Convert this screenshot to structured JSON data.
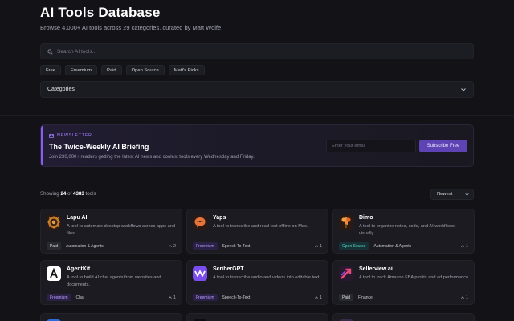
{
  "header": {
    "title": "AI Tools Database",
    "subtitle": "Browse 4,000+ AI tools across 29 categories, curated by Matt Wolfe"
  },
  "search": {
    "placeholder": "Search AI tools..."
  },
  "filters": [
    "Free",
    "Freemium",
    "Paid",
    "Open Source",
    "Matt's Picks"
  ],
  "categories": {
    "label": "Categories"
  },
  "newsletter": {
    "tag": "NEWSLETTER",
    "title": "The Twice-Weekly AI Briefing",
    "description": "Join 230,000+ readers getting the latest AI news and coolest tools every Wednesday and Friday.",
    "email_placeholder": "Enter your email",
    "button": "Subscribe Free"
  },
  "results": {
    "prefix": "Showing",
    "shown": "24",
    "of": "of",
    "total": "4383",
    "suffix": "tools",
    "sort": "Newest"
  },
  "tools": [
    {
      "name": "Lapu AI",
      "description": "A tool to automate desktop workflows across apps and files.",
      "pricing": "Paid",
      "category": "Automation & Agents",
      "votes": "2",
      "icon": "lapu-logo"
    },
    {
      "name": "Yaps",
      "description": "A tool to transcribe and read text offline on Mac.",
      "pricing": "Freemium",
      "category": "Speech-To-Text",
      "votes": "1",
      "icon": "yaps-logo"
    },
    {
      "name": "Dimo",
      "description": "A tool to organize notes, code, and AI workflows visually.",
      "pricing": "Open Source",
      "category": "Automation & Agents",
      "votes": "1",
      "icon": "dimo-logo"
    },
    {
      "name": "AgentKit",
      "description": "A tool to build AI chat agents from websites and documents.",
      "pricing": "Freemium",
      "category": "Chat",
      "votes": "1",
      "icon": "agentkit-logo"
    },
    {
      "name": "ScriberGPT",
      "description": "A tool to transcribe audio and videos into editable text.",
      "pricing": "Freemium",
      "category": "Speech-To-Text",
      "votes": "1",
      "icon": "scribergpt-logo"
    },
    {
      "name": "Sellerview.ai",
      "description": "A tool to track Amazon FBA profits and ad performance.",
      "pricing": "Paid",
      "category": "Finance",
      "votes": "1",
      "icon": "sellerview-logo"
    }
  ],
  "colors": {
    "accent": "#8a5cf6",
    "background": "#121217",
    "card": "#1b1b21"
  }
}
